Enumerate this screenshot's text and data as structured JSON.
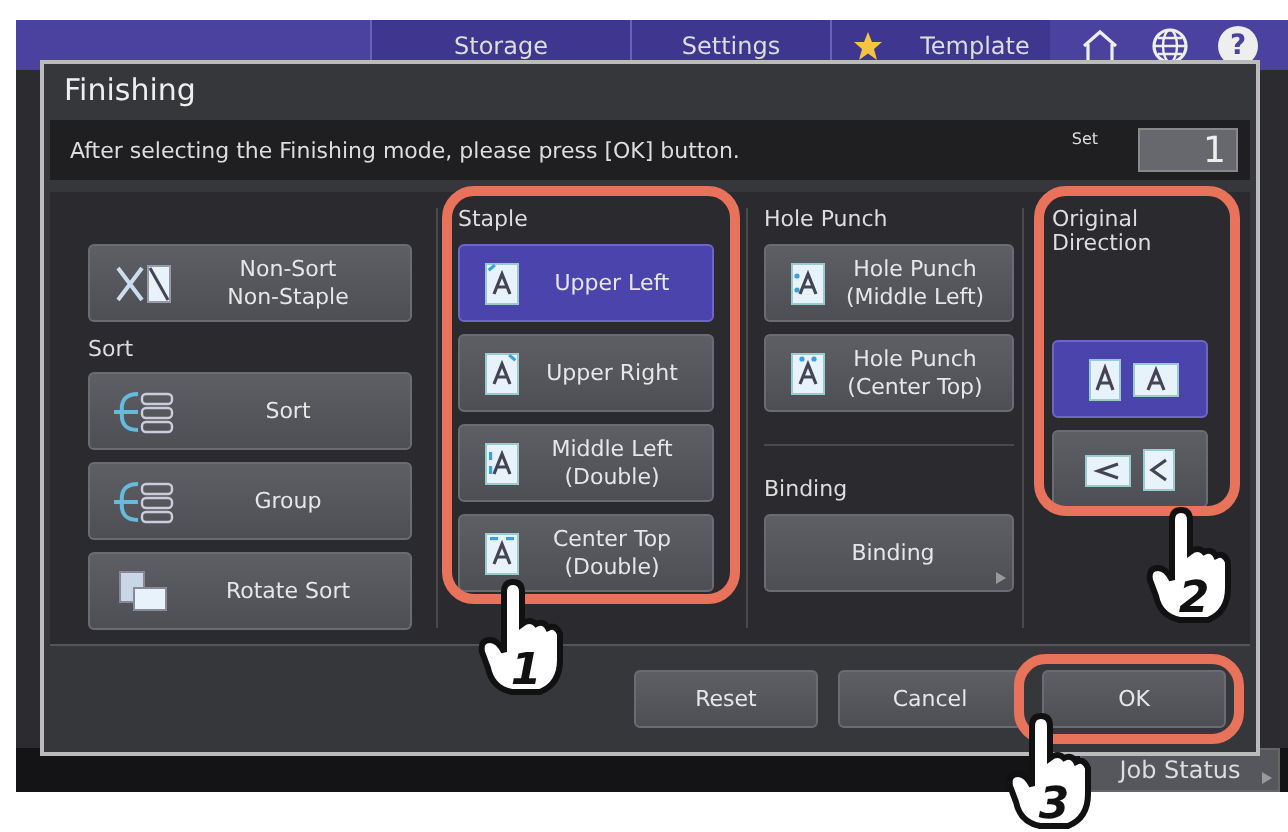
{
  "app_header": {
    "tabs": [
      {
        "label": "Storage",
        "kind": "plain"
      },
      {
        "label": "Settings",
        "kind": "plain"
      },
      {
        "label": "Template",
        "kind": "favorite"
      }
    ],
    "help": "?"
  },
  "dialog": {
    "title": "Finishing",
    "instruction": "After selecting the Finishing mode, please press [OK] button.",
    "set_label": "Set",
    "set_value": "1"
  },
  "non_sort": {
    "label": "Non-Sort\nNon-Staple",
    "kind": "non_sort",
    "selected": false
  },
  "sort": {
    "heading": "Sort",
    "options": [
      {
        "label": "Sort",
        "kind": "sort",
        "selected": false
      },
      {
        "label": "Group",
        "kind": "group",
        "selected": false
      },
      {
        "label": "Rotate Sort",
        "kind": "rotate",
        "selected": false
      }
    ]
  },
  "staple": {
    "heading": "Staple",
    "options": [
      {
        "label": "Upper Left",
        "kind": "upper_left",
        "selected": true
      },
      {
        "label": "Upper Right",
        "kind": "upper_right",
        "selected": false
      },
      {
        "label": "Middle Left\n(Double)",
        "kind": "middle_left",
        "selected": false
      },
      {
        "label": "Center Top\n(Double)",
        "kind": "center_top",
        "selected": false
      }
    ]
  },
  "hole_punch": {
    "heading": "Hole Punch",
    "options": [
      {
        "label": "Hole Punch\n(Middle Left)",
        "kind": "punch_left",
        "selected": false
      },
      {
        "label": "Hole Punch\n(Center Top)",
        "kind": "punch_top",
        "selected": false
      }
    ]
  },
  "binding": {
    "heading": "Binding",
    "button": "Binding"
  },
  "original_direction": {
    "heading": "Original\nDirection",
    "options": [
      {
        "kind": "portrait",
        "selected": true
      },
      {
        "kind": "landscape",
        "selected": false
      }
    ]
  },
  "footer_buttons": [
    "Reset",
    "Cancel",
    "OK"
  ],
  "status_bar": {
    "job_status": "Job Status"
  },
  "annotations": [
    {
      "number": "1"
    },
    {
      "number": "2"
    },
    {
      "number": "3"
    }
  ]
}
